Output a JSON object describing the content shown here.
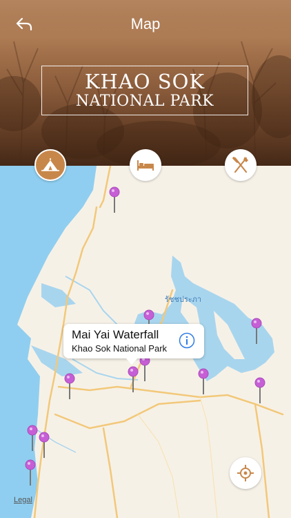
{
  "header": {
    "title": "Map",
    "banner_line1": "KHAO SOK",
    "banner_line2": "NATIONAL PARK"
  },
  "tabs": [
    {
      "name": "camping-tab",
      "icon": "tent-icon",
      "active": true
    },
    {
      "name": "hotels-tab",
      "icon": "bed-icon",
      "active": false
    },
    {
      "name": "restaurants-tab",
      "icon": "fork-knife-icon",
      "active": false
    }
  ],
  "map": {
    "place_label": "รัชชประภา",
    "legal": "Legal",
    "callout": {
      "title": "Mai Yai Waterfall",
      "subtitle": "Khao Sok National Park"
    }
  },
  "colors": {
    "accent": "#c8874a",
    "pin": "#c65fd6",
    "water": "#a8d5ee",
    "sea": "#8fcef0",
    "land": "#f6f1e7",
    "road": "#f2c879"
  }
}
